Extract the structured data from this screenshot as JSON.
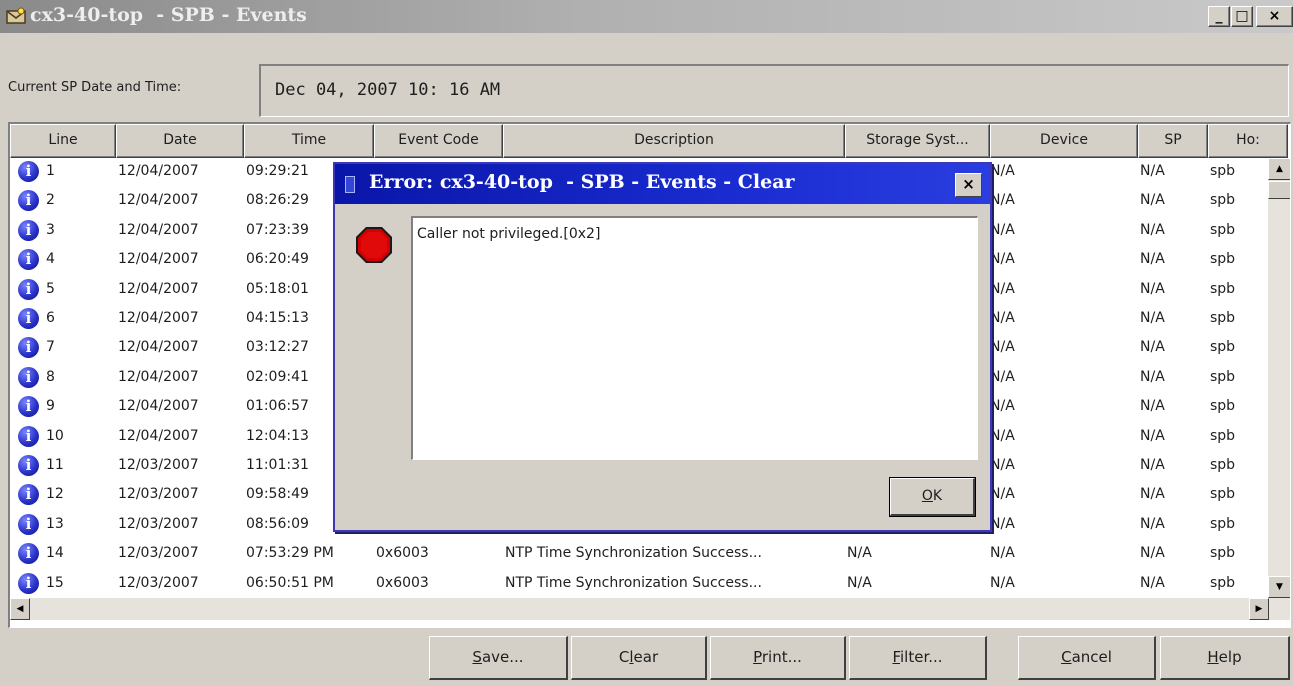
{
  "window": {
    "title": "cx3-40-top  - SPB - Events",
    "min_glyph": "_",
    "max_glyph": "□",
    "close_glyph": "×"
  },
  "current": {
    "label": "Current SP Date and Time:",
    "value": "Dec 04, 2007 10: 16 AM"
  },
  "table": {
    "columns": [
      "Line",
      "Date",
      "Time",
      "Event Code",
      "Description",
      "Storage Syst...",
      "Device",
      "SP",
      "Ho:"
    ],
    "rows": [
      {
        "line": "1",
        "date": "12/04/2007",
        "time": "09:29:21",
        "code": "",
        "desc": "",
        "storage": "",
        "device": "N/A",
        "sp": "N/A",
        "host": "spb"
      },
      {
        "line": "2",
        "date": "12/04/2007",
        "time": "08:26:29",
        "code": "",
        "desc": "",
        "storage": "",
        "device": "N/A",
        "sp": "N/A",
        "host": "spb"
      },
      {
        "line": "3",
        "date": "12/04/2007",
        "time": "07:23:39",
        "code": "",
        "desc": "",
        "storage": "",
        "device": "N/A",
        "sp": "N/A",
        "host": "spb"
      },
      {
        "line": "4",
        "date": "12/04/2007",
        "time": "06:20:49",
        "code": "",
        "desc": "",
        "storage": "",
        "device": "N/A",
        "sp": "N/A",
        "host": "spb"
      },
      {
        "line": "5",
        "date": "12/04/2007",
        "time": "05:18:01",
        "code": "",
        "desc": "",
        "storage": "",
        "device": "N/A",
        "sp": "N/A",
        "host": "spb"
      },
      {
        "line": "6",
        "date": "12/04/2007",
        "time": "04:15:13",
        "code": "",
        "desc": "",
        "storage": "",
        "device": "N/A",
        "sp": "N/A",
        "host": "spb"
      },
      {
        "line": "7",
        "date": "12/04/2007",
        "time": "03:12:27",
        "code": "",
        "desc": "",
        "storage": "",
        "device": "N/A",
        "sp": "N/A",
        "host": "spb"
      },
      {
        "line": "8",
        "date": "12/04/2007",
        "time": "02:09:41",
        "code": "",
        "desc": "",
        "storage": "",
        "device": "N/A",
        "sp": "N/A",
        "host": "spb"
      },
      {
        "line": "9",
        "date": "12/04/2007",
        "time": "01:06:57",
        "code": "",
        "desc": "",
        "storage": "",
        "device": "N/A",
        "sp": "N/A",
        "host": "spb"
      },
      {
        "line": "10",
        "date": "12/04/2007",
        "time": "12:04:13",
        "code": "",
        "desc": "",
        "storage": "",
        "device": "N/A",
        "sp": "N/A",
        "host": "spb"
      },
      {
        "line": "11",
        "date": "12/03/2007",
        "time": "11:01:31",
        "code": "",
        "desc": "",
        "storage": "",
        "device": "N/A",
        "sp": "N/A",
        "host": "spb"
      },
      {
        "line": "12",
        "date": "12/03/2007",
        "time": "09:58:49",
        "code": "",
        "desc": "",
        "storage": "",
        "device": "N/A",
        "sp": "N/A",
        "host": "spb"
      },
      {
        "line": "13",
        "date": "12/03/2007",
        "time": "08:56:09",
        "code": "",
        "desc": "",
        "storage": "",
        "device": "N/A",
        "sp": "N/A",
        "host": "spb"
      },
      {
        "line": "14",
        "date": "12/03/2007",
        "time": "07:53:29 PM",
        "code": "0x6003",
        "desc": "NTP Time Synchronization Success...",
        "storage": "N/A",
        "device": "N/A",
        "sp": "N/A",
        "host": "spb"
      },
      {
        "line": "15",
        "date": "12/03/2007",
        "time": "06:50:51 PM",
        "code": "0x6003",
        "desc": "NTP Time Synchronization Success...",
        "storage": "N/A",
        "device": "N/A",
        "sp": "N/A",
        "host": "spb"
      }
    ],
    "row_icon_glyph": "i",
    "scroll_up_glyph": "▲",
    "scroll_down_glyph": "▼",
    "scroll_left_glyph": "◀",
    "scroll_right_glyph": "▶"
  },
  "buttons": {
    "save": {
      "mnemonic": "S",
      "rest": "ave..."
    },
    "clear": {
      "pre": "C",
      "mnemonic": "l",
      "rest": "ear"
    },
    "print": {
      "mnemonic": "P",
      "rest": "rint..."
    },
    "filter": {
      "mnemonic": "F",
      "rest": "ilter..."
    },
    "cancel": {
      "mnemonic": "C",
      "rest": "ancel"
    },
    "help": {
      "mnemonic": "H",
      "rest": "elp"
    }
  },
  "dialog": {
    "title": "Error: cx3-40-top  - SPB - Events - Clear",
    "close_glyph": "×",
    "message": "Caller not privileged.[0x2]",
    "ok": {
      "mnemonic": "O",
      "rest": "K"
    },
    "icon": "stop-icon",
    "accent": "#1a2cd0"
  },
  "colors": {
    "window_bg": "#d4d0c8",
    "info_icon": "#2a33c9",
    "stop_icon": "#cc0000"
  }
}
